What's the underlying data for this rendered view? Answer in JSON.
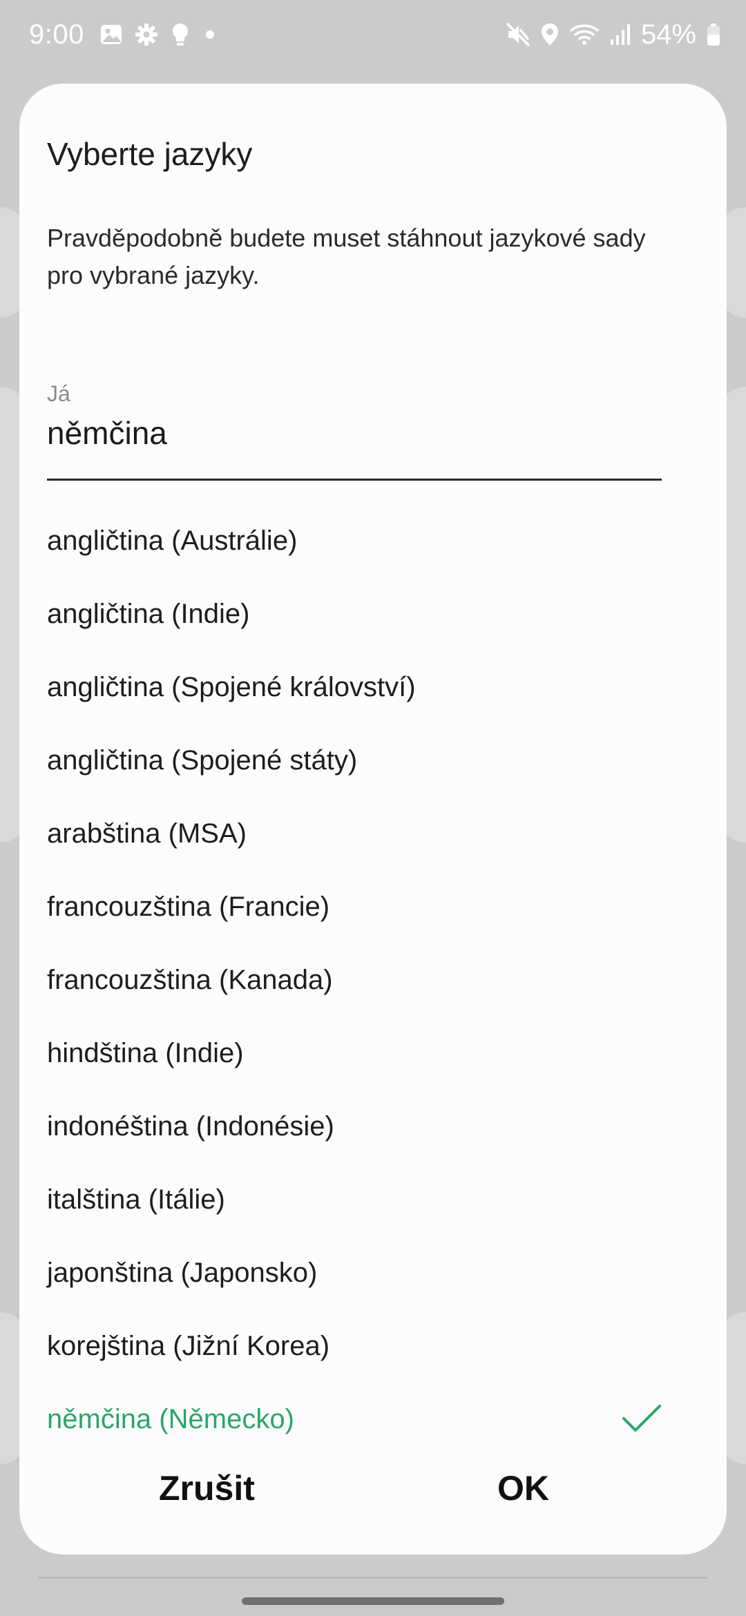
{
  "status_bar": {
    "time": "9:00",
    "battery_percent": "54%",
    "left_icons": [
      "gallery-icon",
      "settings-gear-icon",
      "lightbulb-icon",
      "dot-icon"
    ],
    "right_icons": [
      "mute-icon",
      "location-icon",
      "wifi-icon",
      "signal-icon",
      "battery-icon"
    ]
  },
  "dialog": {
    "title": "Vyberte jazyky",
    "description": "Pravděpodobně budete muset stáhnout jazykové sady pro vybrané jazyky.",
    "field": {
      "label": "Já",
      "value": "němčina"
    },
    "languages": [
      {
        "label": "angličtina (Austrálie)",
        "selected": false
      },
      {
        "label": "angličtina (Indie)",
        "selected": false
      },
      {
        "label": "angličtina (Spojené království)",
        "selected": false
      },
      {
        "label": "angličtina (Spojené státy)",
        "selected": false
      },
      {
        "label": "arabština (MSA)",
        "selected": false
      },
      {
        "label": "francouzština (Francie)",
        "selected": false
      },
      {
        "label": "francouzština (Kanada)",
        "selected": false
      },
      {
        "label": "hindština (Indie)",
        "selected": false
      },
      {
        "label": "indonéština (Indonésie)",
        "selected": false
      },
      {
        "label": "italština (Itálie)",
        "selected": false
      },
      {
        "label": "japonština (Japonsko)",
        "selected": false
      },
      {
        "label": "korejština (Jižní Korea)",
        "selected": false
      },
      {
        "label": "němčina (Německo)",
        "selected": true
      }
    ],
    "buttons": {
      "cancel": "Zrušit",
      "ok": "OK"
    }
  },
  "colors": {
    "accent": "#2aa56b",
    "dialog_background": "#fcfcfd",
    "scrim": "#cbcbcb"
  }
}
